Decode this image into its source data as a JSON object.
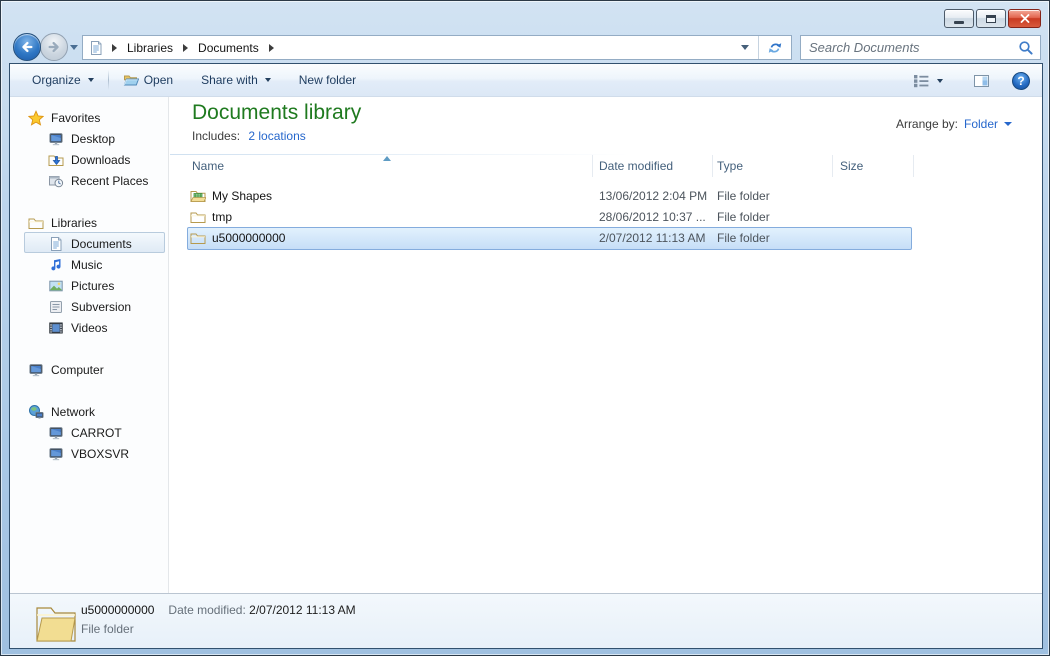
{
  "window": {
    "buttons": {
      "minimize": "minimize",
      "maximize": "maximize",
      "close": "close"
    }
  },
  "address_bar": {
    "crumbs": [
      "Libraries",
      "Documents"
    ],
    "search_placeholder": "Search Documents"
  },
  "toolbar": {
    "organize": "Organize",
    "open": "Open",
    "share_with": "Share with",
    "new_folder": "New folder"
  },
  "sidebar": {
    "favorites": {
      "label": "Favorites",
      "items": [
        {
          "label": "Desktop"
        },
        {
          "label": "Downloads"
        },
        {
          "label": "Recent Places"
        }
      ]
    },
    "libraries": {
      "label": "Libraries",
      "items": [
        {
          "label": "Documents",
          "selected": true
        },
        {
          "label": "Music"
        },
        {
          "label": "Pictures"
        },
        {
          "label": "Subversion"
        },
        {
          "label": "Videos"
        }
      ]
    },
    "computer": {
      "label": "Computer"
    },
    "network": {
      "label": "Network",
      "items": [
        {
          "label": "CARROT"
        },
        {
          "label": "VBOXSVR"
        }
      ]
    }
  },
  "main": {
    "title": "Documents library",
    "includes_label": "Includes:",
    "includes_link": "2 locations",
    "arrange_label": "Arrange by:",
    "arrange_value": "Folder",
    "columns": [
      "Name",
      "Date modified",
      "Type",
      "Size"
    ],
    "rows": [
      {
        "name": "My Shapes",
        "date": "13/06/2012 2:04 PM",
        "type": "File folder",
        "size": "",
        "selected": false
      },
      {
        "name": "tmp",
        "date": "28/06/2012 10:37 ...",
        "type": "File folder",
        "size": "",
        "selected": false
      },
      {
        "name": "u5000000000",
        "date": "2/07/2012 11:13 AM",
        "type": "File folder",
        "size": "",
        "selected": true
      }
    ]
  },
  "details": {
    "name": "u5000000000",
    "date_label": "Date modified:",
    "date": "2/07/2012 11:13 AM",
    "type": "File folder"
  },
  "icons": {
    "back": "back-arrow-circle",
    "forward": "forward-arrow-circle",
    "nav_dropdown": "chevron-down",
    "address_file": "document",
    "address_dropdown": "chevron-down",
    "refresh": "refresh-arrows",
    "search": "magnifier",
    "organize_dropdown": "chevron-down",
    "open": "open-folder",
    "share_dropdown": "chevron-down",
    "views": "list-view",
    "views_dropdown": "chevron-down",
    "preview": "preview-pane",
    "help_glyph": "?",
    "sort": "sort-ascending-arrow",
    "folder": "folder",
    "my_shapes_folder": "shapes-folder"
  },
  "colors": {
    "title_green": "#1f7a1f",
    "link_blue": "#2667cc",
    "selection_border": "#84acdd",
    "selection_fill": "#c6def7",
    "frame_blue": "#a9c8e6",
    "close_red": "#d85b3e"
  }
}
